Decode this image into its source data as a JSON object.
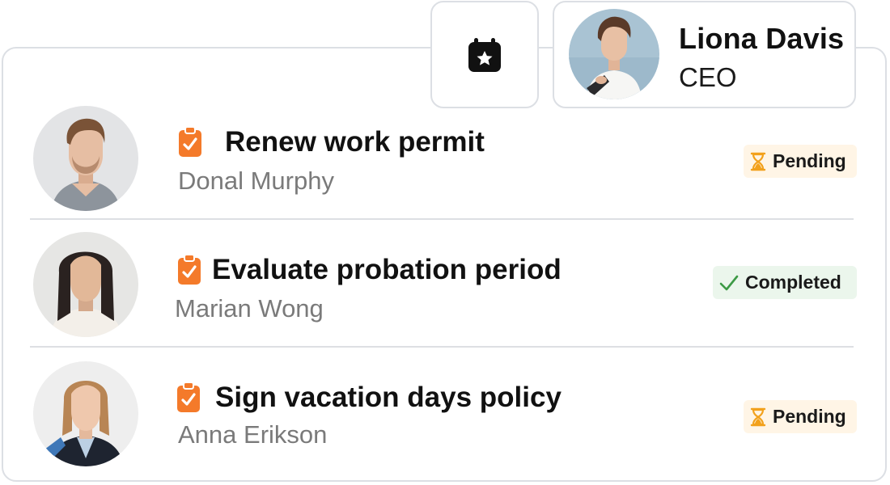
{
  "profile": {
    "name": "Liona Davis",
    "role": "CEO",
    "avatar": "woman-holding-tablet-photo"
  },
  "calendar_button": {
    "icon": "calendar-star-icon"
  },
  "tasks": [
    {
      "title": "Renew work permit",
      "assignee": "Donal Murphy",
      "status": "Pending",
      "status_icon": "hourglass-icon",
      "task_icon": "clipboard-check-icon"
    },
    {
      "title": "Evaluate probation period",
      "assignee": "Marian Wong",
      "status": "Completed",
      "status_icon": "checkmark-icon",
      "task_icon": "clipboard-check-icon"
    },
    {
      "title": "Sign vacation days policy",
      "assignee": "Anna Erikson",
      "status": "Pending",
      "status_icon": "hourglass-icon",
      "task_icon": "clipboard-check-icon"
    }
  ],
  "colors": {
    "accent_orange": "#f47a2a",
    "pending_bg": "#fff5e6",
    "pending_icon": "#f2a11c",
    "completed_bg": "#ebf6ec",
    "completed_icon": "#3c9a45",
    "border": "#dcdfe4"
  }
}
